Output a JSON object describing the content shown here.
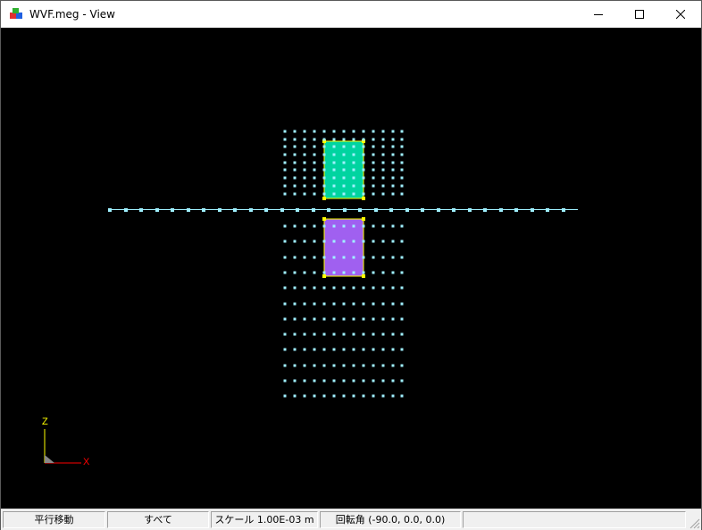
{
  "window": {
    "title": "WVF.meg - View",
    "app_icon": "cubes-icon",
    "controls": {
      "minimize": "minimize-icon",
      "maximize": "maximize-icon",
      "close": "close-icon"
    }
  },
  "axis": {
    "z_label": "Z",
    "x_label": "X",
    "z_color": "#ffff00",
    "x_color": "#ff0000"
  },
  "colors": {
    "mesh_point": "#9ff0ff",
    "upper_region": "#00d4a0",
    "lower_region": "#a060f0",
    "region_border": "#ffff00",
    "background": "#000000"
  },
  "status": {
    "mode": "平行移動",
    "selection": "すべて",
    "scale": "スケール 1.00E-03 m",
    "rotation": "回転角 (-90.0, 0.0, 0.0)",
    "extra": ""
  }
}
